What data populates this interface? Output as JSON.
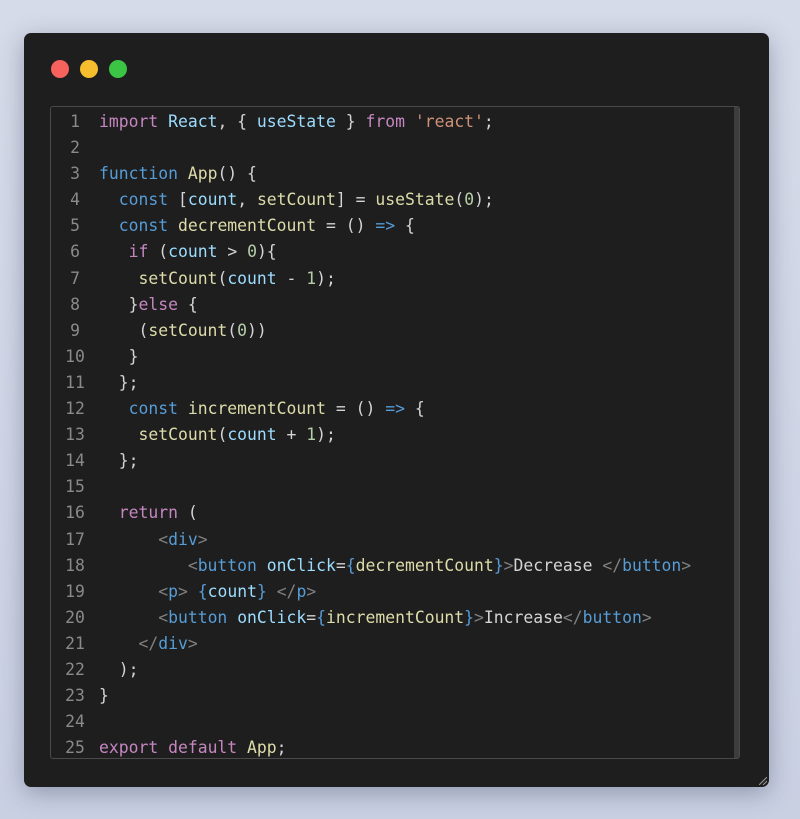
{
  "window": {
    "controls": [
      "close-icon",
      "minimize-icon",
      "maximize-icon"
    ],
    "colors": {
      "close": "#f7625d",
      "minimize": "#f6bd2e",
      "maximize": "#3cc444"
    }
  },
  "syntax_colors": {
    "default": "#d4d4d4",
    "keyword": "#c586c0",
    "storage": "#569cd6",
    "variable": "#9cdcfe",
    "function": "#dcdcaa",
    "string": "#ce9178",
    "number": "#b5cea8",
    "tag": "#569cd6",
    "tag_bracket": "#808080",
    "line_number": "#8a8a8a"
  },
  "code_lines": [
    {
      "n": "1",
      "tokens": [
        [
          "import",
          "keyword"
        ],
        [
          " ",
          "default"
        ],
        [
          "React",
          "variable"
        ],
        [
          ", { ",
          "default"
        ],
        [
          "useState",
          "variable"
        ],
        [
          " } ",
          "default"
        ],
        [
          "from",
          "keyword"
        ],
        [
          " ",
          "default"
        ],
        [
          "'react'",
          "string"
        ],
        [
          ";",
          "default"
        ]
      ]
    },
    {
      "n": "2",
      "tokens": []
    },
    {
      "n": "3",
      "tokens": [
        [
          "function",
          "storage"
        ],
        [
          " ",
          "default"
        ],
        [
          "App",
          "function"
        ],
        [
          "() {",
          "default"
        ]
      ]
    },
    {
      "n": "4",
      "tokens": [
        [
          "  ",
          "default"
        ],
        [
          "const",
          "storage"
        ],
        [
          " [",
          "default"
        ],
        [
          "count",
          "variable"
        ],
        [
          ", ",
          "default"
        ],
        [
          "setCount",
          "function"
        ],
        [
          "] = ",
          "default"
        ],
        [
          "useState",
          "function"
        ],
        [
          "(",
          "default"
        ],
        [
          "0",
          "number"
        ],
        [
          ");",
          "default"
        ]
      ]
    },
    {
      "n": "5",
      "tokens": [
        [
          "  ",
          "default"
        ],
        [
          "const",
          "storage"
        ],
        [
          " ",
          "default"
        ],
        [
          "decrementCount",
          "function"
        ],
        [
          " = () ",
          "default"
        ],
        [
          "=>",
          "storage"
        ],
        [
          " {",
          "default"
        ]
      ]
    },
    {
      "n": "6",
      "tokens": [
        [
          "   ",
          "default"
        ],
        [
          "if",
          "keyword"
        ],
        [
          " (",
          "default"
        ],
        [
          "count",
          "variable"
        ],
        [
          " > ",
          "default"
        ],
        [
          "0",
          "number"
        ],
        [
          "){",
          "default"
        ]
      ]
    },
    {
      "n": "7",
      "tokens": [
        [
          "    ",
          "default"
        ],
        [
          "setCount",
          "function"
        ],
        [
          "(",
          "default"
        ],
        [
          "count",
          "variable"
        ],
        [
          " - ",
          "default"
        ],
        [
          "1",
          "number"
        ],
        [
          ");",
          "default"
        ]
      ]
    },
    {
      "n": "8",
      "tokens": [
        [
          "   }",
          "default"
        ],
        [
          "else",
          "keyword"
        ],
        [
          " {",
          "default"
        ]
      ]
    },
    {
      "n": "9",
      "tokens": [
        [
          "    (",
          "default"
        ],
        [
          "setCount",
          "function"
        ],
        [
          "(",
          "default"
        ],
        [
          "0",
          "number"
        ],
        [
          "))",
          "default"
        ]
      ]
    },
    {
      "n": "10",
      "tokens": [
        [
          "   }",
          "default"
        ]
      ]
    },
    {
      "n": "11",
      "tokens": [
        [
          "  };",
          "default"
        ]
      ]
    },
    {
      "n": "12",
      "tokens": [
        [
          "   ",
          "default"
        ],
        [
          "const",
          "storage"
        ],
        [
          " ",
          "default"
        ],
        [
          "incrementCount",
          "function"
        ],
        [
          " = () ",
          "default"
        ],
        [
          "=>",
          "storage"
        ],
        [
          " {",
          "default"
        ]
      ]
    },
    {
      "n": "13",
      "tokens": [
        [
          "    ",
          "default"
        ],
        [
          "setCount",
          "function"
        ],
        [
          "(",
          "default"
        ],
        [
          "count",
          "variable"
        ],
        [
          " + ",
          "default"
        ],
        [
          "1",
          "number"
        ],
        [
          ");",
          "default"
        ]
      ]
    },
    {
      "n": "14",
      "tokens": [
        [
          "  };",
          "default"
        ]
      ]
    },
    {
      "n": "15",
      "tokens": []
    },
    {
      "n": "16",
      "tokens": [
        [
          "  ",
          "default"
        ],
        [
          "return",
          "keyword"
        ],
        [
          " (",
          "default"
        ]
      ]
    },
    {
      "n": "17",
      "tokens": [
        [
          "      ",
          "default"
        ],
        [
          "<",
          "tag_bracket"
        ],
        [
          "div",
          "tag"
        ],
        [
          ">",
          "tag_bracket"
        ]
      ]
    },
    {
      "n": "18",
      "tokens": [
        [
          "         ",
          "default"
        ],
        [
          "<",
          "tag_bracket"
        ],
        [
          "button",
          "tag"
        ],
        [
          " ",
          "default"
        ],
        [
          "onClick",
          "variable"
        ],
        [
          "=",
          "default"
        ],
        [
          "{",
          "storage"
        ],
        [
          "decrementCount",
          "function"
        ],
        [
          "}",
          "storage"
        ],
        [
          ">",
          "tag_bracket"
        ],
        [
          "Decrease ",
          "default"
        ],
        [
          "</",
          "tag_bracket"
        ],
        [
          "button",
          "tag"
        ],
        [
          ">",
          "tag_bracket"
        ]
      ]
    },
    {
      "n": "19",
      "tokens": [
        [
          "      ",
          "default"
        ],
        [
          "<",
          "tag_bracket"
        ],
        [
          "p",
          "tag"
        ],
        [
          ">",
          "tag_bracket"
        ],
        [
          " ",
          "default"
        ],
        [
          "{",
          "storage"
        ],
        [
          "count",
          "variable"
        ],
        [
          "}",
          "storage"
        ],
        [
          " ",
          "default"
        ],
        [
          "</",
          "tag_bracket"
        ],
        [
          "p",
          "tag"
        ],
        [
          ">",
          "tag_bracket"
        ]
      ]
    },
    {
      "n": "20",
      "tokens": [
        [
          "      ",
          "default"
        ],
        [
          "<",
          "tag_bracket"
        ],
        [
          "button",
          "tag"
        ],
        [
          " ",
          "default"
        ],
        [
          "onClick",
          "variable"
        ],
        [
          "=",
          "default"
        ],
        [
          "{",
          "storage"
        ],
        [
          "incrementCount",
          "function"
        ],
        [
          "}",
          "storage"
        ],
        [
          ">",
          "tag_bracket"
        ],
        [
          "Increase",
          "default"
        ],
        [
          "</",
          "tag_bracket"
        ],
        [
          "button",
          "tag"
        ],
        [
          ">",
          "tag_bracket"
        ]
      ]
    },
    {
      "n": "21",
      "tokens": [
        [
          "    ",
          "default"
        ],
        [
          "</",
          "tag_bracket"
        ],
        [
          "div",
          "tag"
        ],
        [
          ">",
          "tag_bracket"
        ]
      ]
    },
    {
      "n": "22",
      "tokens": [
        [
          "  );",
          "default"
        ]
      ]
    },
    {
      "n": "23",
      "tokens": [
        [
          "}",
          "default"
        ]
      ]
    },
    {
      "n": "24",
      "tokens": []
    },
    {
      "n": "25",
      "tokens": [
        [
          "export",
          "keyword"
        ],
        [
          " ",
          "default"
        ],
        [
          "default",
          "keyword"
        ],
        [
          " ",
          "default"
        ],
        [
          "App",
          "function"
        ],
        [
          ";",
          "default"
        ]
      ]
    }
  ]
}
